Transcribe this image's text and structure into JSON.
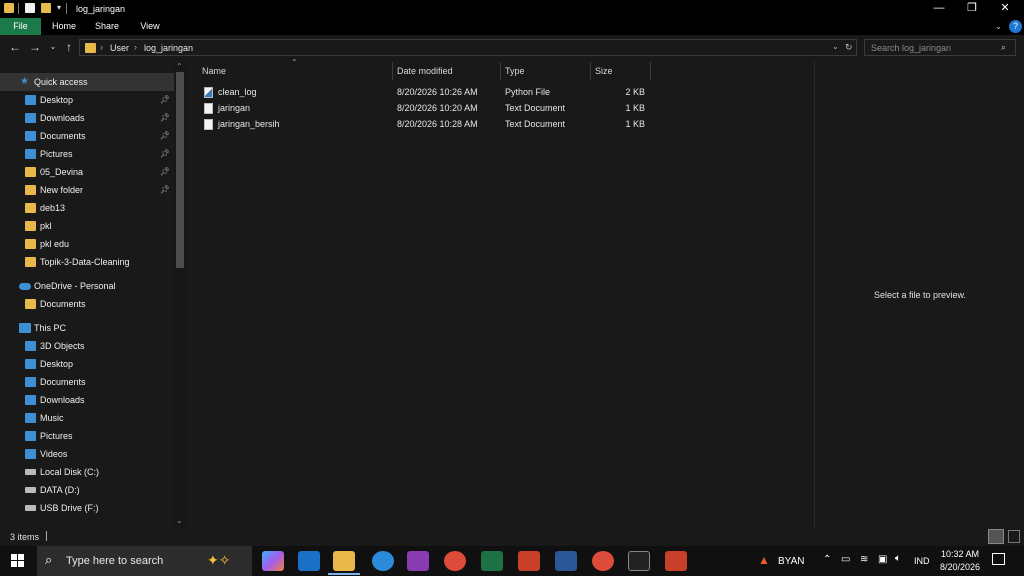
{
  "window": {
    "title": "log_jaringan",
    "controls": {
      "minimize": "—",
      "restore": "❐",
      "close": "✕"
    },
    "help": "?"
  },
  "ribbon": {
    "tabs": [
      "File",
      "Home",
      "Share",
      "View"
    ]
  },
  "address": {
    "breadcrumb": [
      "User",
      "log_jaringan"
    ],
    "search_placeholder": "Search log_jaringan"
  },
  "sidebar": {
    "quick_access": "Quick access",
    "quick_items": [
      {
        "label": "Desktop",
        "icon": "desktop-icon",
        "pinned": true
      },
      {
        "label": "Downloads",
        "icon": "download-icon",
        "pinned": true
      },
      {
        "label": "Documents",
        "icon": "documents-icon",
        "pinned": true
      },
      {
        "label": "Pictures",
        "icon": "pictures-icon",
        "pinned": true
      },
      {
        "label": "05_Devina",
        "icon": "folder-icon",
        "pinned": true
      },
      {
        "label": "New folder",
        "icon": "folder-icon",
        "pinned": true
      },
      {
        "label": "deb13",
        "icon": "folder-icon",
        "pinned": false
      },
      {
        "label": "pkl",
        "icon": "folder-icon",
        "pinned": false
      },
      {
        "label": "pkl edu",
        "icon": "folder-icon",
        "pinned": false
      },
      {
        "label": "Topik-3-Data-Cleaning",
        "icon": "folder-icon",
        "pinned": false
      }
    ],
    "onedrive": "OneDrive - Personal",
    "onedrive_items": [
      {
        "label": "Documents",
        "icon": "folder-icon"
      }
    ],
    "this_pc": "This PC",
    "pc_items": [
      {
        "label": "3D Objects",
        "icon": "3d-objects-icon"
      },
      {
        "label": "Desktop",
        "icon": "desktop-icon"
      },
      {
        "label": "Documents",
        "icon": "documents-icon"
      },
      {
        "label": "Downloads",
        "icon": "download-icon"
      },
      {
        "label": "Music",
        "icon": "music-icon"
      },
      {
        "label": "Pictures",
        "icon": "pictures-icon"
      },
      {
        "label": "Videos",
        "icon": "videos-icon"
      },
      {
        "label": "Local Disk (C:)",
        "icon": "drive-icon"
      },
      {
        "label": "DATA (D:)",
        "icon": "drive-icon"
      },
      {
        "label": "USB Drive (F:)",
        "icon": "usb-drive-icon"
      }
    ]
  },
  "filelist": {
    "columns": [
      "Name",
      "Date modified",
      "Type",
      "Size"
    ],
    "rows": [
      {
        "name": "clean_log",
        "date": "8/20/2026 10:26 AM",
        "type": "Python File",
        "size": "2 KB",
        "icon": "python-file-icon"
      },
      {
        "name": "jaringan",
        "date": "8/20/2026 10:20 AM",
        "type": "Text Document",
        "size": "1 KB",
        "icon": "text-file-icon"
      },
      {
        "name": "jaringan_bersih",
        "date": "8/20/2026 10:28 AM",
        "type": "Text Document",
        "size": "1 KB",
        "icon": "text-file-icon"
      }
    ]
  },
  "preview": {
    "message": "Select a file to preview."
  },
  "status": {
    "items": "3 items"
  },
  "taskbar": {
    "search_placeholder": "Type here to search",
    "user": "BYAN",
    "language": "IND",
    "time": "10:32 AM",
    "date": "8/20/2026"
  },
  "colors": {
    "accent_file_tab": "#1b7a4a",
    "folder": "#e8b84a",
    "background": "#191919"
  }
}
